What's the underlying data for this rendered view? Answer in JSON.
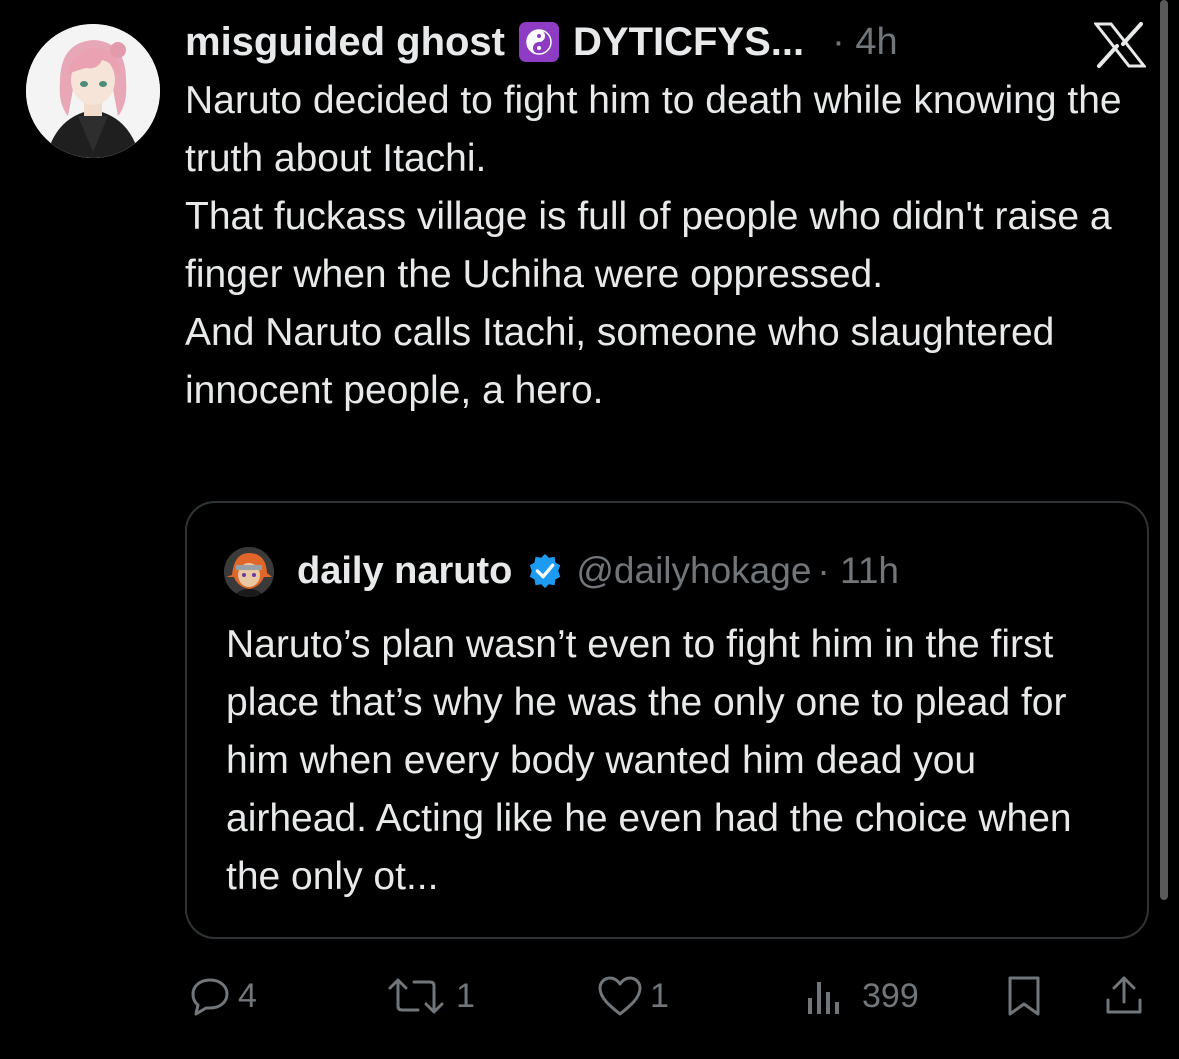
{
  "tweet": {
    "display_name": "misguided ghost",
    "handle_truncated": "DYTICFYS...",
    "time": "· 4h",
    "body_lines": [
      "Naruto decided to fight him to death while knowing the truth about Itachi.",
      "That fuckass village is full of people who didn't raise a finger when the Uchiha were oppressed.",
      "And Naruto calls Itachi, someone who slaughtered innocent people, a hero."
    ],
    "icons": {
      "badge": "yin-yang-icon",
      "platform": "x-logo-icon"
    }
  },
  "quote": {
    "display_name": "daily naruto",
    "handle": "@dailyhokage",
    "time": "· 11h",
    "text": "Naruto’s plan wasn’t even to fight him in the first place that’s why he was the only one to plead for him when every body wanted him dead you airhead. Acting like he even had the choice when the only ot...",
    "verified_icon": "verified-badge-icon"
  },
  "actions": {
    "replies": "4",
    "reposts": "1",
    "likes": "1",
    "views": "399"
  },
  "colors": {
    "background": "#000000",
    "text": "#e7e9ea",
    "muted": "#71767b",
    "border": "#2f3336",
    "verified": "#1d9bf0",
    "badge": "#8e3cc4"
  }
}
